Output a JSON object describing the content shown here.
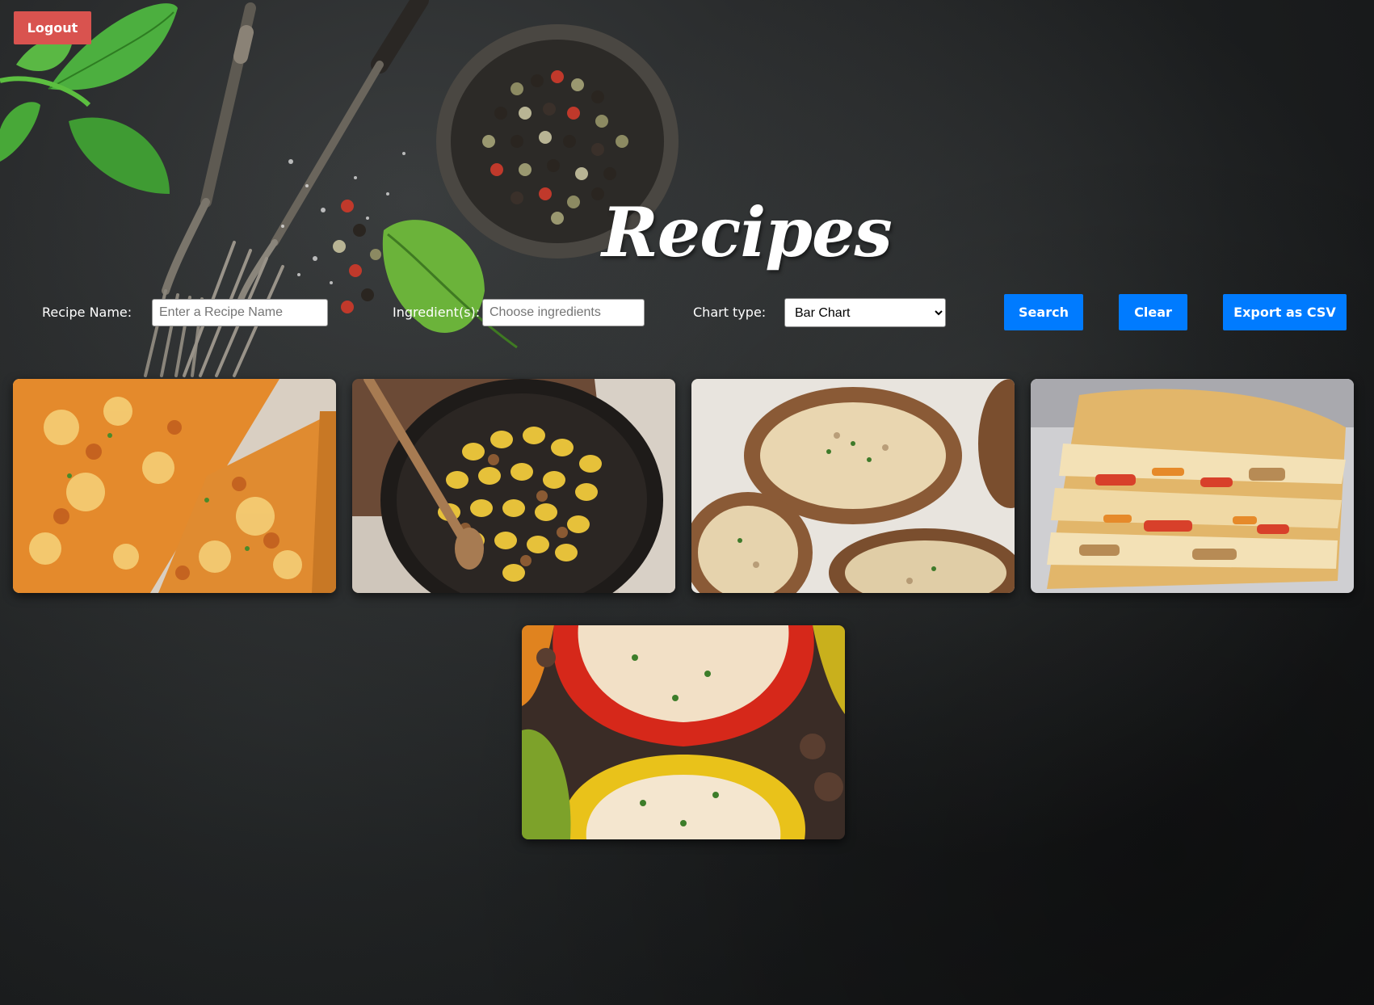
{
  "header": {
    "logout_label": "Logout",
    "title": "Recipes"
  },
  "filters": {
    "recipe_name_label": "Recipe Name:",
    "recipe_name_placeholder": "Enter a Recipe Name",
    "ingredients_label": "Ingredient(s):",
    "ingredients_placeholder": "Choose ingredients",
    "chart_type_label": "Chart type:",
    "chart_type_selected": "Bar Chart"
  },
  "actions": {
    "search_label": "Search",
    "clear_label": "Clear",
    "export_label": "Export as CSV"
  },
  "recipes": [
    {
      "image": "bbq-chicken-pizza-photo"
    },
    {
      "image": "gnocchi-skillet-photo"
    },
    {
      "image": "baked-potatoes-photo"
    },
    {
      "image": "chicken-quesadilla-photo"
    },
    {
      "image": "stuffed-peppers-photo"
    }
  ],
  "colors": {
    "logout_bg": "#d9534f",
    "action_bg": "#007bff",
    "background": "#1b1d1e"
  }
}
